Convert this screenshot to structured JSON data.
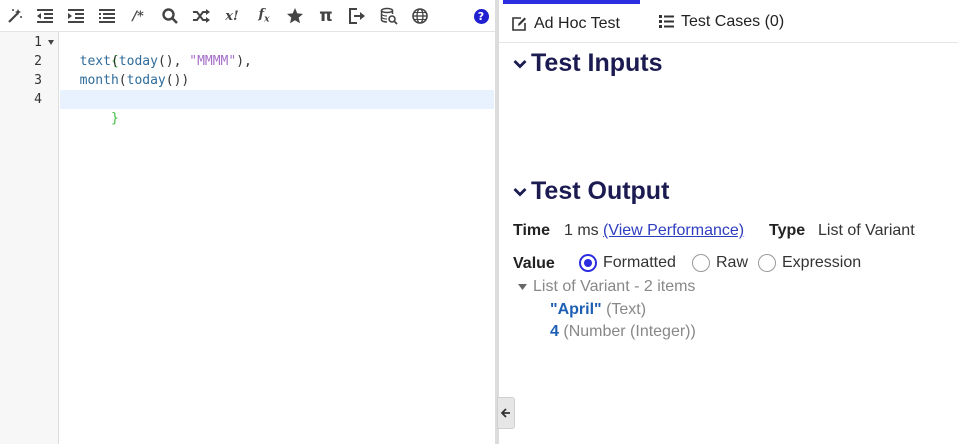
{
  "editor": {
    "line_numbers": [
      "1",
      "2",
      "3",
      "4"
    ],
    "lines": {
      "l1_brace": "{",
      "l2_fn1": "text",
      "l2_p1": "(",
      "l2_fn2": "today",
      "l2_p2": "(), ",
      "l2_str": "\"MMMM\"",
      "l2_p3": "),",
      "l3_fn1": "month",
      "l3_p1": "(",
      "l3_fn2": "today",
      "l3_p2": "())",
      "l4_brace": "}"
    }
  },
  "toolbar": {
    "comment_label": "/*",
    "error_label": "x!",
    "function_label": "f",
    "function_sub": "x",
    "pi_label": "π",
    "help_label": "?"
  },
  "tabs": {
    "adhoc_label": "Ad Hoc Test",
    "testcases_label": "Test Cases (0)"
  },
  "test_inputs": {
    "heading": "Test Inputs"
  },
  "test_output": {
    "heading": "Test Output",
    "time_label": "Time",
    "time_value": "1 ms",
    "view_performance": "(View Performance)",
    "type_label": "Type",
    "type_value": "List of Variant",
    "value_label": "Value",
    "radio_formatted": "Formatted",
    "radio_raw": "Raw",
    "radio_expression": "Expression",
    "selected_mode": "Formatted",
    "tree": {
      "root": "List of Variant - 2 items",
      "items": [
        {
          "value": "\"April\"",
          "type": "(Text)"
        },
        {
          "value": "4",
          "type": "(Number (Integer))"
        }
      ]
    }
  },
  "colors": {
    "accent": "#2c2ce0",
    "heading": "#1b1b52",
    "value_blue": "#1d5fb4",
    "help_blue": "#2020d0"
  }
}
